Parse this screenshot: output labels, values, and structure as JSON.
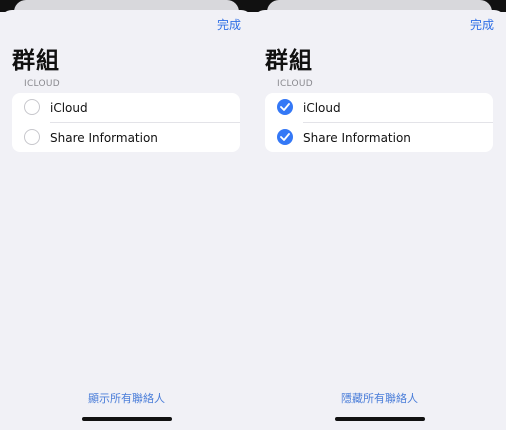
{
  "panels": [
    {
      "done_label": "完成",
      "title": "群組",
      "section_header": "ICLOUD",
      "items": [
        {
          "label": "iCloud",
          "checked": false
        },
        {
          "label": "Share Information",
          "checked": false
        }
      ],
      "footer_link": "顯示所有聯絡人"
    },
    {
      "done_label": "完成",
      "title": "群組",
      "section_header": "ICLOUD",
      "items": [
        {
          "label": "iCloud",
          "checked": true
        },
        {
          "label": "Share Information",
          "checked": true
        }
      ],
      "footer_link": "隱藏所有聯絡人"
    }
  ],
  "colors": {
    "accent": "#3478f6",
    "background": "#f1f1f6",
    "card": "#ffffff",
    "unchecked_border": "#c7c7cc"
  },
  "icons": {
    "checked": "checkmark-circle-filled-icon",
    "unchecked": "empty-circle-icon"
  }
}
